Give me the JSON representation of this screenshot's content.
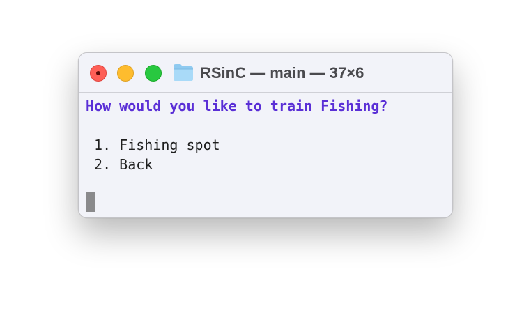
{
  "window": {
    "title": "RSinC — main — 37×6",
    "folder_icon": "folder-icon"
  },
  "traffic_lights": {
    "close": "close-button",
    "minimize": "minimize-button",
    "zoom": "zoom-button"
  },
  "terminal": {
    "question": "How would you like to train Fishing?",
    "options": [
      " 1. Fishing spot",
      " 2. Back"
    ]
  },
  "colors": {
    "prompt": "#5a2fd6",
    "background": "#f2f3f9",
    "close": "#fe5f57",
    "minimize": "#febc2e",
    "zoom": "#28c840"
  }
}
